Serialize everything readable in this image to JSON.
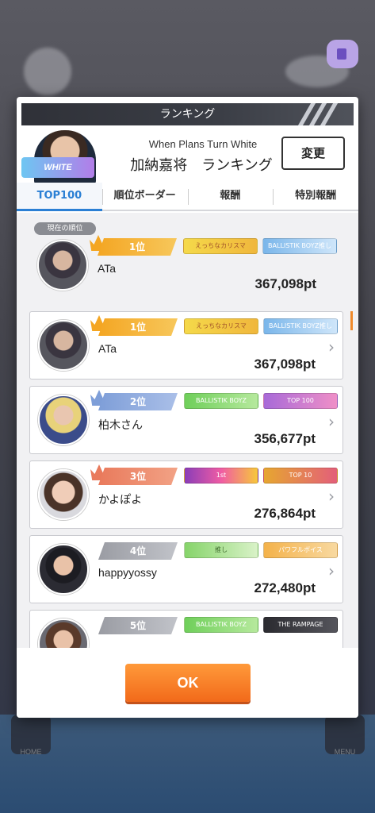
{
  "dialog": {
    "title": "ランキング",
    "event_logo": "WHITE",
    "event_name": "When Plans Turn White",
    "ranking_title": "加納嘉将　ランキング",
    "change_label": "変更"
  },
  "tabs": [
    {
      "label": "TOP100",
      "active": true
    },
    {
      "label": "順位ボーダー",
      "active": false
    },
    {
      "label": "報酬",
      "active": false
    },
    {
      "label": "特別報酬",
      "active": false
    }
  ],
  "current_rank_label": "現在の順位",
  "current": {
    "rank": "1位",
    "name": "ATa",
    "points": "367,098pt",
    "title1": "えっちなカリスマ",
    "title2": "BALLISTIK BOYZ推し"
  },
  "rows": [
    {
      "rank": "1位",
      "name": "ATa",
      "points": "367,098pt",
      "title1": "えっちなカリスマ",
      "title2": "BALLISTIK BOYZ推し"
    },
    {
      "rank": "2位",
      "name": "柏木さん",
      "points": "356,677pt",
      "title1": "BALLISTIK BOYZ",
      "title2": "TOP 100"
    },
    {
      "rank": "3位",
      "name": "かよぽよ",
      "points": "276,864pt",
      "title1": "1st",
      "title2": "TOP 10"
    },
    {
      "rank": "4位",
      "name": "happyyossy",
      "points": "272,480pt",
      "title1": "推し",
      "title2": "パワフルボイス"
    },
    {
      "rank": "5位",
      "name": "",
      "points": "",
      "title1": "BALLISTIK BOYZ",
      "title2": "THE RAMPAGE"
    }
  ],
  "ok_label": "OK",
  "nav": {
    "home_label": "HOME",
    "menu_label": "MENU"
  }
}
